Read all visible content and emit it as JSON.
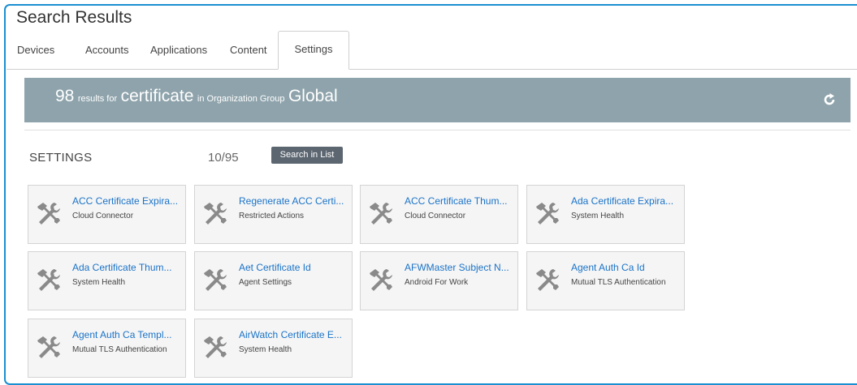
{
  "page": {
    "title": "Search Results"
  },
  "tabs": [
    {
      "label": "Devices"
    },
    {
      "label": "Accounts"
    },
    {
      "label": "Applications"
    },
    {
      "label": "Content"
    },
    {
      "label": "Settings",
      "active": true
    }
  ],
  "banner": {
    "count": "98",
    "results_for": "results for",
    "query": "certificate",
    "in_org_group": "in Organization Group",
    "group": "Global",
    "refresh_icon": "refresh-icon",
    "background_color": "#8ea3ab"
  },
  "section": {
    "title": "SETTINGS",
    "count": "10/95",
    "search_button": "Search in List"
  },
  "settings_icon": "tools-icon",
  "cards": [
    {
      "title": "ACC Certificate Expira...",
      "subtitle": "Cloud Connector"
    },
    {
      "title": "Regenerate ACC Certi...",
      "subtitle": "Restricted Actions"
    },
    {
      "title": "ACC Certificate Thum...",
      "subtitle": "Cloud Connector"
    },
    {
      "title": "Ada Certificate Expira...",
      "subtitle": "System Health"
    },
    {
      "title": "Ada Certificate Thum...",
      "subtitle": "System Health"
    },
    {
      "title": "Aet Certificate Id",
      "subtitle": "Agent Settings"
    },
    {
      "title": "AFWMaster Subject N...",
      "subtitle": "Android For Work"
    },
    {
      "title": "Agent Auth Ca Id",
      "subtitle": "Mutual TLS Authentication"
    },
    {
      "title": "Agent Auth Ca Templ...",
      "subtitle": "Mutual TLS Authentication"
    },
    {
      "title": "AirWatch Certificate E...",
      "subtitle": "System Health"
    }
  ],
  "colors": {
    "accent": "#1a8fd1",
    "link": "#1a73c8",
    "button": "#5c6670"
  }
}
